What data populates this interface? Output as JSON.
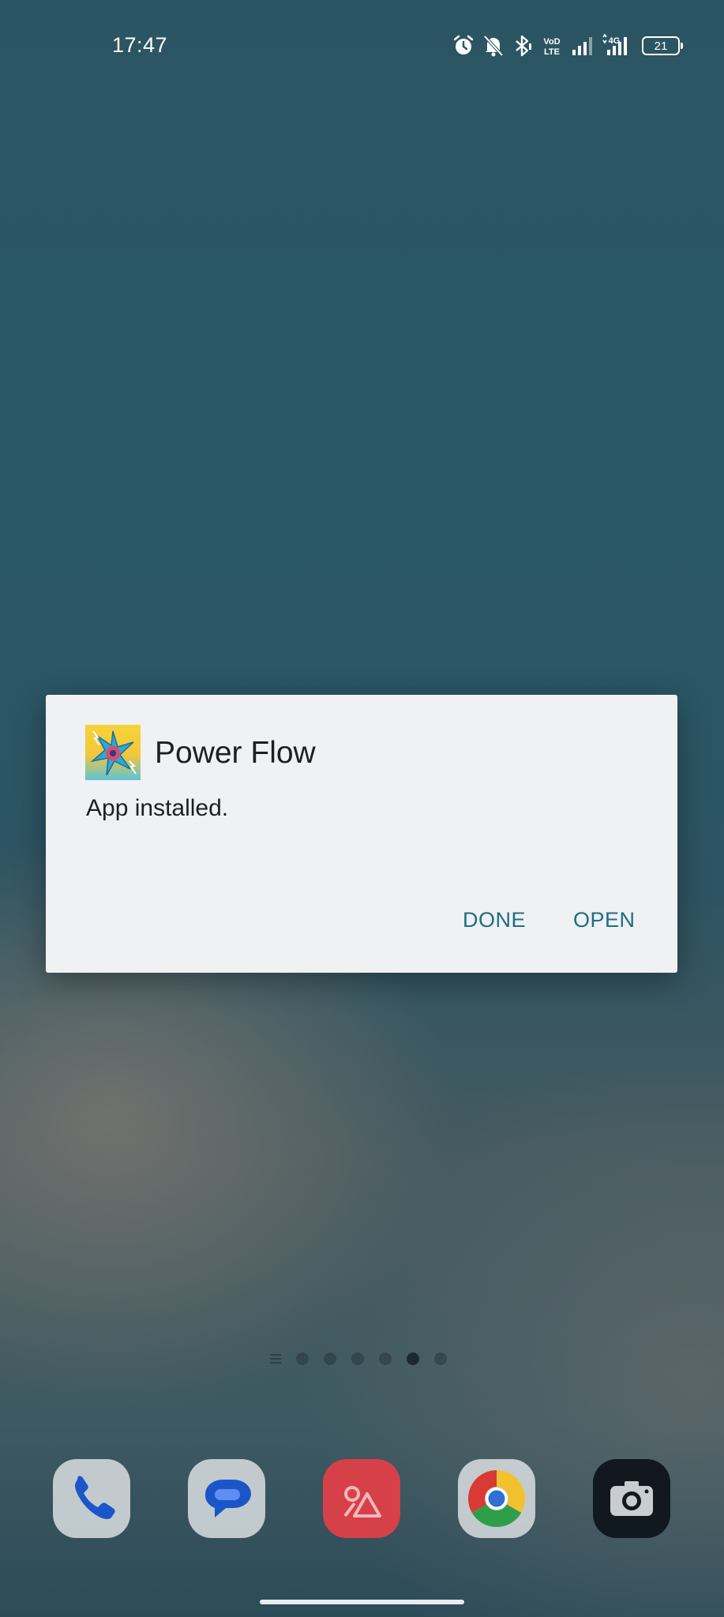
{
  "status_bar": {
    "time": "17:47",
    "icons": [
      "alarm-icon",
      "muted-bell-icon",
      "bluetooth-icon",
      "volte-icon",
      "signal-icon",
      "4g-signal-icon",
      "battery-icon"
    ],
    "volte_label": "VoLTE",
    "network_label": "4G",
    "battery_level": "21"
  },
  "dialog": {
    "app_name": "Power Flow",
    "message": "App installed.",
    "done_label": "DONE",
    "open_label": "OPEN",
    "accent_color": "#1f6e80"
  },
  "home": {
    "page_count": 6,
    "active_page": 5,
    "dock_apps": [
      "Phone",
      "Messages",
      "Gallery",
      "Chrome",
      "Camera"
    ]
  }
}
